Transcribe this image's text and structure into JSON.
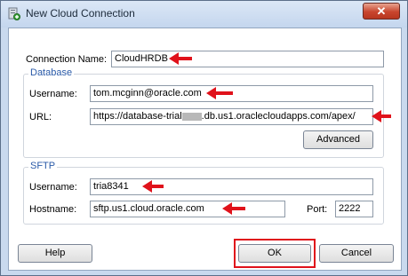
{
  "window": {
    "title": "New Cloud Connection",
    "close_glyph": "✕"
  },
  "connection": {
    "label": "Connection Name:",
    "value": "CloudHRDB"
  },
  "database": {
    "group_title": "Database",
    "username_label": "Username:",
    "username_value": "tom.mcginn@oracle.com",
    "url_label": "URL:",
    "url_prefix": "https://database-trial",
    "url_suffix": ".db.us1.oraclecloudapps.com/apex/",
    "advanced_label": "Advanced"
  },
  "sftp": {
    "group_title": "SFTP",
    "username_label": "Username:",
    "username_value": "tria8341",
    "hostname_label": "Hostname:",
    "hostname_value": "sftp.us1.cloud.oracle.com",
    "port_label": "Port:",
    "port_value": "2222"
  },
  "buttons": {
    "help": "Help",
    "ok": "OK",
    "cancel": "Cancel"
  },
  "colors": {
    "annotation": "#e0121b",
    "group_title": "#2a5aa8"
  }
}
